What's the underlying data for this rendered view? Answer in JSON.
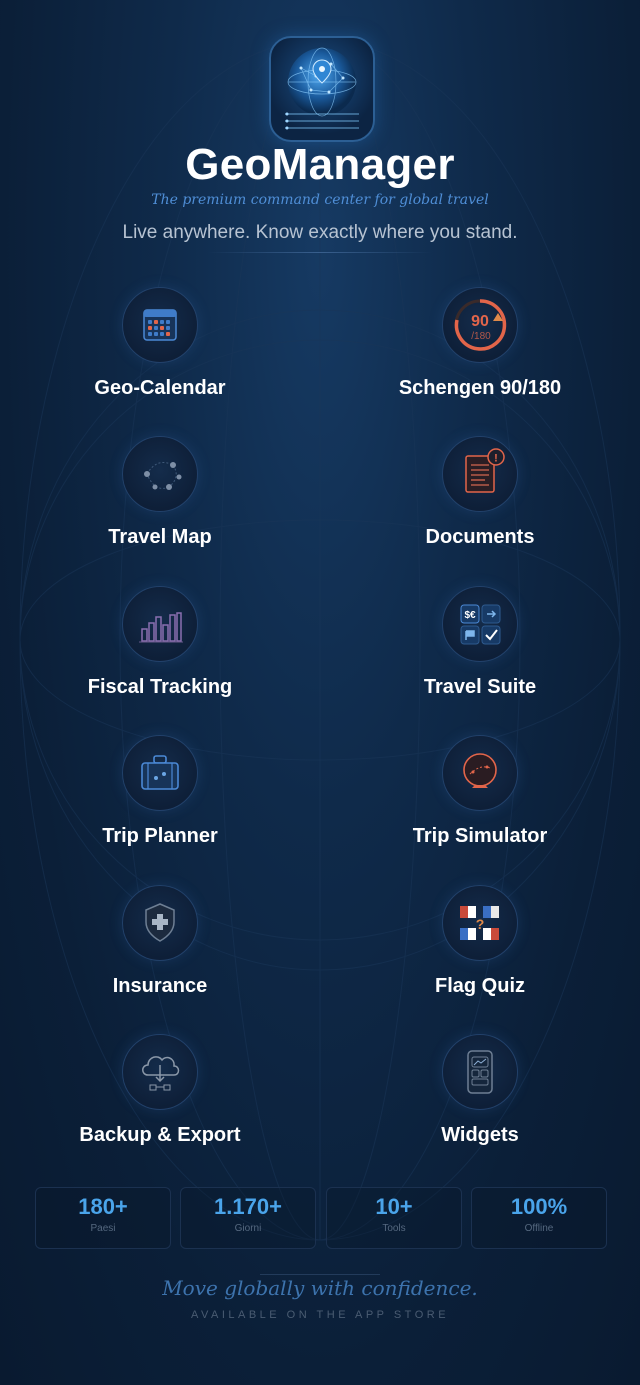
{
  "header": {
    "title": "GeoManager",
    "tagline": "The premium command center for global travel",
    "subtitle": "Live anywhere. Know exactly where you stand."
  },
  "features": [
    {
      "label": "Geo-Calendar",
      "icon": "calendar-icon"
    },
    {
      "label": "Schengen 90/180",
      "icon": "schengen-gauge-icon",
      "gauge_value": "90",
      "gauge_total": "/180"
    },
    {
      "label": "Travel Map",
      "icon": "travel-map-icon"
    },
    {
      "label": "Documents",
      "icon": "documents-icon",
      "badge": "!"
    },
    {
      "label": "Fiscal Tracking",
      "icon": "bar-chart-icon"
    },
    {
      "label": "Travel Suite",
      "icon": "travel-suite-icon",
      "currency": "$€"
    },
    {
      "label": "Trip Planner",
      "icon": "suitcase-icon"
    },
    {
      "label": "Trip Simulator",
      "icon": "simulator-globe-icon"
    },
    {
      "label": "Insurance",
      "icon": "shield-icon"
    },
    {
      "label": "Flag Quiz",
      "icon": "flag-quiz-icon",
      "quiz_mark": "?"
    },
    {
      "label": "Backup & Export",
      "icon": "cloud-download-icon"
    },
    {
      "label": "Widgets",
      "icon": "phone-widget-icon"
    }
  ],
  "stats": [
    {
      "value": "180+",
      "label": "Paesi"
    },
    {
      "value": "1.170+",
      "label": "Giorni"
    },
    {
      "value": "10+",
      "label": "Tools"
    },
    {
      "value": "100%",
      "label": "Offline"
    }
  ],
  "footer": {
    "slogan": "Move globally with confidence.",
    "store": "AVAILABLE ON THE APP STORE"
  },
  "colors": {
    "accent_blue": "#4aa4ea",
    "accent_orange": "#e2654a",
    "background": "#0b1f38"
  }
}
